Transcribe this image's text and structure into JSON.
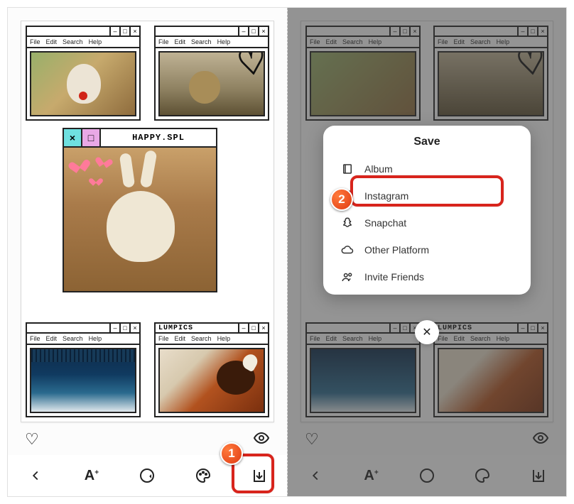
{
  "retro_menu": [
    "File",
    "Edit",
    "Search",
    "Help"
  ],
  "center_window": {
    "title": "HAPPY.SPL",
    "btn_close_glyph": "×",
    "btn_min_glyph": "□"
  },
  "bottom_right_window_title": "LUMPICS",
  "save_modal": {
    "title": "Save",
    "items": [
      {
        "label": "Album"
      },
      {
        "label": "Instagram"
      },
      {
        "label": "Snapchat"
      },
      {
        "label": "Other Platform"
      },
      {
        "label": "Invite Friends"
      }
    ],
    "close_glyph": "✕"
  },
  "annotations": {
    "step1": "1",
    "step2": "2"
  }
}
